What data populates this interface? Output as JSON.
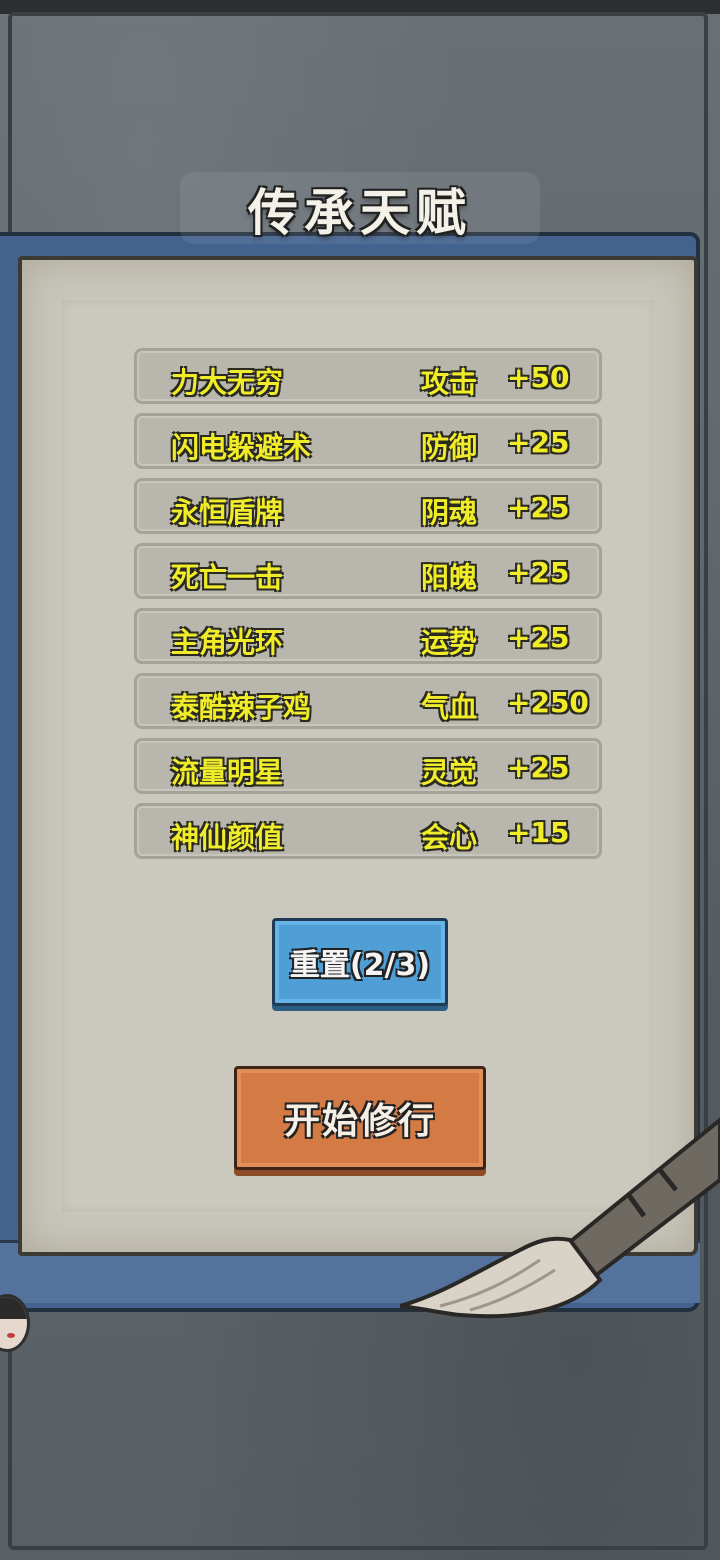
{
  "title": "传承天赋",
  "talents": [
    {
      "name": "力大无穷",
      "stat": "攻击",
      "bonus": "+50"
    },
    {
      "name": "闪电躲避术",
      "stat": "防御",
      "bonus": "+25"
    },
    {
      "name": "永恒盾牌",
      "stat": "阴魂",
      "bonus": "+25"
    },
    {
      "name": "死亡一击",
      "stat": "阳魄",
      "bonus": "+25"
    },
    {
      "name": "主角光环",
      "stat": "运势",
      "bonus": "+25"
    },
    {
      "name": "泰酷辣子鸡",
      "stat": "气血",
      "bonus": "+250"
    },
    {
      "name": "流量明星",
      "stat": "灵觉",
      "bonus": "+25"
    },
    {
      "name": "神仙颜值",
      "stat": "会心",
      "bonus": "+15"
    }
  ],
  "buttons": {
    "reset_label": "重置(2/3)",
    "start_label": "开始修行"
  },
  "colors": {
    "talent_text": "#f0ec2a",
    "reset_button": "#4f9fd6",
    "start_button": "#d47b45",
    "book_cover": "#44628e",
    "paper": "#c9c6bb"
  },
  "icons": {
    "decoration": "brush-icon",
    "avatar": "avatar-icon"
  }
}
